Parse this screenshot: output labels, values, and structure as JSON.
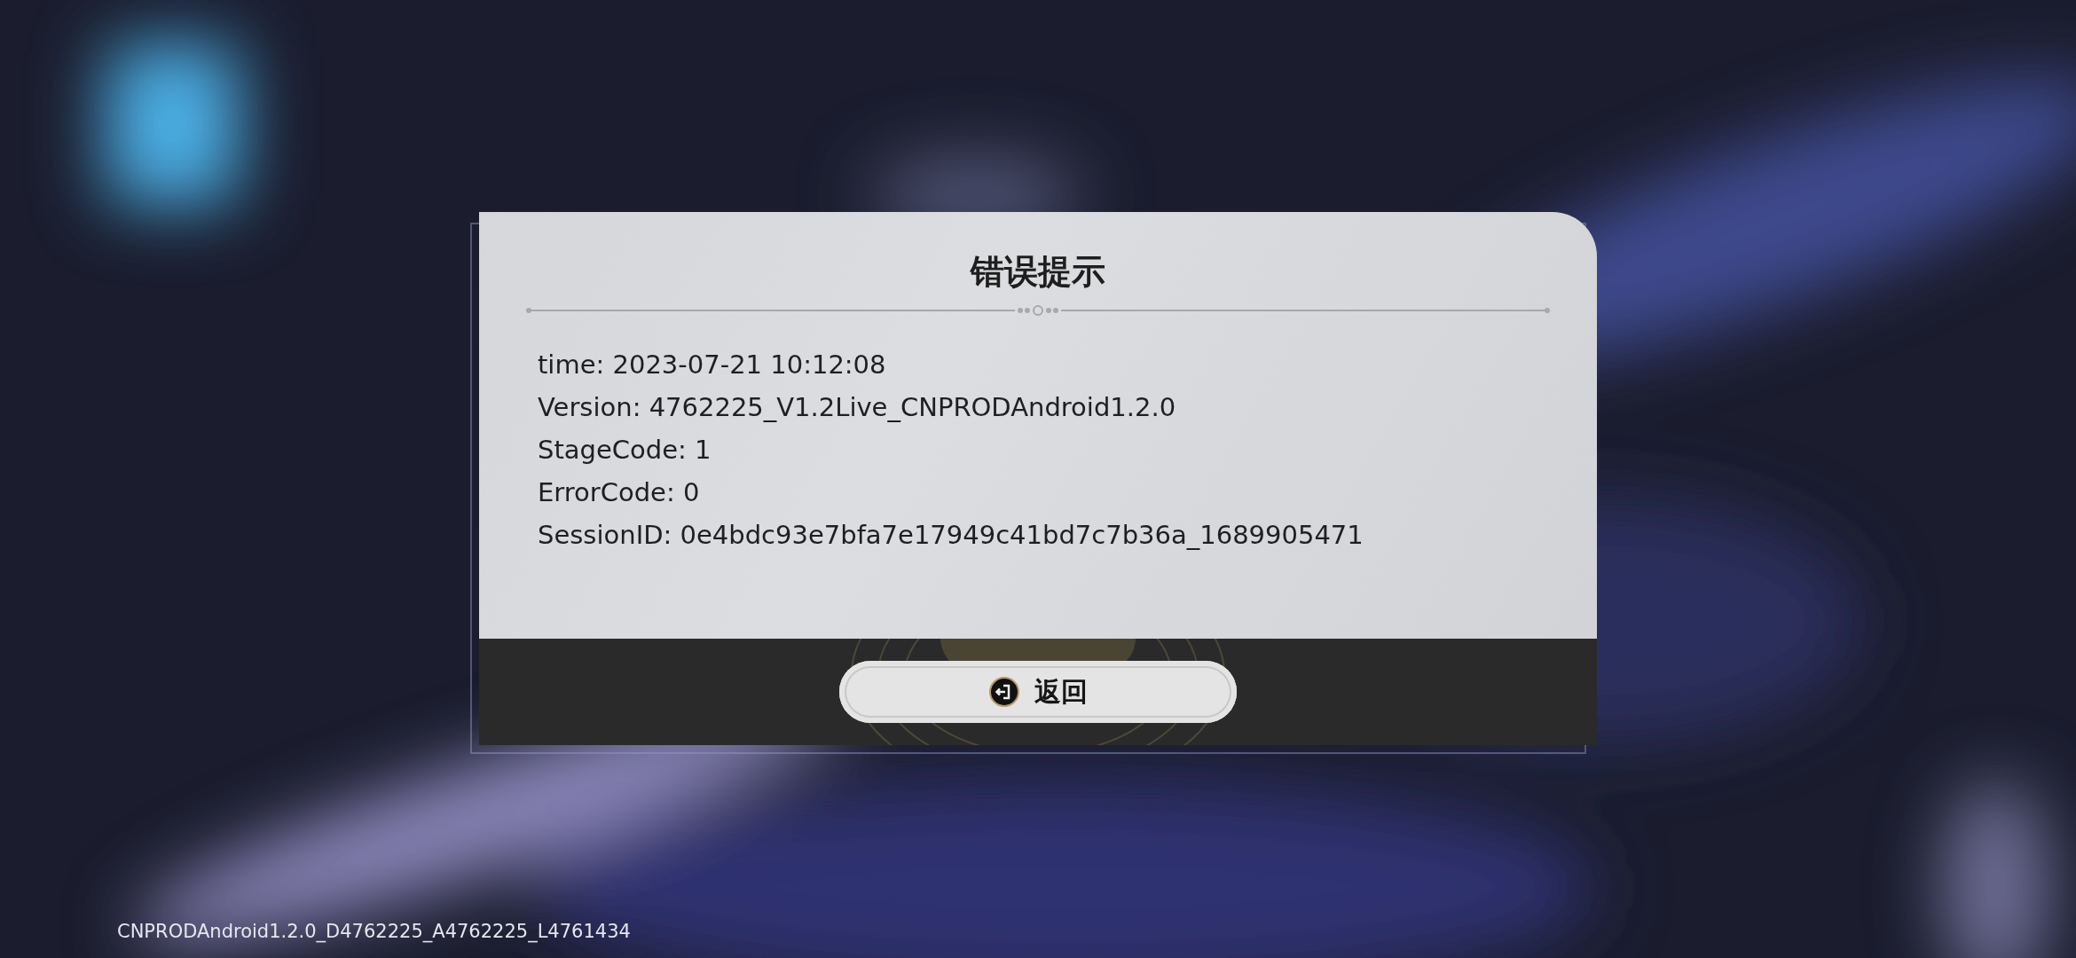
{
  "dialog": {
    "title": "错误提示",
    "lines": [
      "time: 2023-07-21 10:12:08",
      "Version: 4762225_V1.2Live_CNPRODAndroid1.2.0",
      "StageCode: 1",
      "ErrorCode: 0",
      "SessionID: 0e4bdc93e7bfa7e17949c41bd7c7b36a_1689905471"
    ],
    "button": {
      "label": "返回"
    }
  },
  "build_label": "CNPRODAndroid1.2.0_D4762225_A4762225_L4761434"
}
